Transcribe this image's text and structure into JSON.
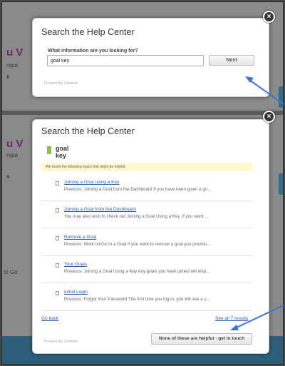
{
  "background": {
    "letters_top": "u V",
    "letters_bottom": "u V",
    "fragment_prep_1": "repa",
    "fragment_prep_2": "repa",
    "fragment_s1": "s",
    "fragment_s2": "s",
    "fragment_to_goal": "to Go"
  },
  "search_modal": {
    "title": "Search the Help Center",
    "question": "What information are you looking for?",
    "query_value": "goal key",
    "next_label": "Next",
    "powered_by": "Powered by Zendesk",
    "close_icon": "×"
  },
  "results_modal": {
    "title": "Search the Help Center",
    "query": "goal key",
    "notice": "We found the following topics that might be helpful:",
    "results": [
      {
        "title": "Joining a Goal using a Key",
        "snippet": "Previous: Joining a Goal from the Dashboard  If you have been given a go..."
      },
      {
        "title": "Joining a Goal from the Dashboard",
        "snippet": "You may also wish to check out Joining a Goal Using a Key.   If you want ..."
      },
      {
        "title": "Remove a Goal",
        "snippet": "Previous: Work on/Go to a Goal   If you want to remove a goal you previou..."
      },
      {
        "title": "Your Goals",
        "snippet": "Previous: Joining a Goal Using a Key   Any goals you have joined will disp..."
      },
      {
        "title": "Initial Login",
        "snippet": "Previous: Forgot Your Password The first time you log in, you will see a s..."
      }
    ],
    "go_back": "Go back",
    "see_all": "See all 7 results",
    "none_helpful": "None of these are helpful - get in touch",
    "powered_by": "Powered by Zendesk",
    "close_icon": "×"
  },
  "colors": {
    "accent_green": "#8cc63f",
    "link_blue": "#2a5db0",
    "arrow_blue": "#3b73d6",
    "notice_yellow": "#fdf8cf"
  }
}
